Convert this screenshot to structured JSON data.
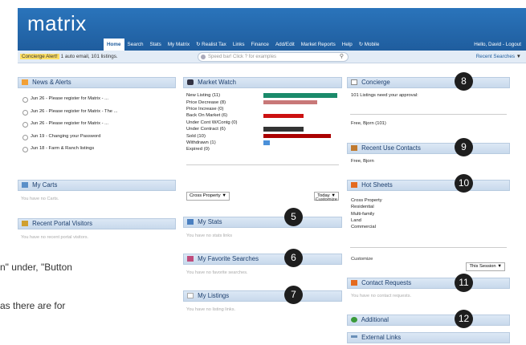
{
  "app": {
    "logo": "matrix"
  },
  "nav": {
    "items": [
      "Home",
      "Search",
      "Stats",
      "My Matrix",
      "Realist Tax",
      "Links",
      "Finance",
      "Add/Edit",
      "Market Reports",
      "Help",
      "Mobile"
    ],
    "active": "Home",
    "user_links": "Hello, David - Logout"
  },
  "subbar": {
    "alert_label": "Concierge Alert!",
    "alert_text": "1 auto email, 101 listings.",
    "speedbar_placeholder": "Speed bar! Click ? for examples",
    "recent_searches": "Recent Searches"
  },
  "news": {
    "title": "News & Alerts",
    "items": [
      "Jun 26 - Please register for Matrix - ...",
      "Jun 26 - Please register for Matrix - The ...",
      "Jun 26 - Please register for Matrix - ...",
      "Jun 19 - Changing your Password",
      "Jun 18 - Farm & Ranch listings"
    ]
  },
  "carts": {
    "title": "My Carts",
    "empty": "You have no Carts."
  },
  "portal": {
    "title": "Recent Portal Visitors",
    "empty": "You have no recent portal visitors."
  },
  "market_watch": {
    "title": "Market Watch",
    "rows": [
      {
        "label": "New Listing (11)",
        "value": 11,
        "color": "#1a8a6a"
      },
      {
        "label": "Price Decrease (8)",
        "value": 8,
        "color": "#c87878"
      },
      {
        "label": "Price Increase (0)",
        "value": 0,
        "color": "#999999"
      },
      {
        "label": "Back On Market (6)",
        "value": 6,
        "color": "#cc1111"
      },
      {
        "label": "Under Cont W/Contg (0)",
        "value": 0,
        "color": "#999999"
      },
      {
        "label": "Under Contract (6)",
        "value": 6,
        "color": "#333333"
      },
      {
        "label": "Sold (10)",
        "value": 10,
        "color": "#aa0000"
      },
      {
        "label": "Withdrawn (1)",
        "value": 1,
        "color": "#4a90d9"
      },
      {
        "label": "Expired (0)",
        "value": 0,
        "color": "#999999"
      }
    ],
    "max_value": 11,
    "property_select": "Cross Property",
    "period_select": "Today",
    "customize": "Customize"
  },
  "my_stats": {
    "title": "My Stats",
    "empty": "You have no stats links"
  },
  "fav_searches": {
    "title": "My Favorite Searches",
    "empty": "You have no favorite searches."
  },
  "my_listings": {
    "title": "My Listings",
    "empty": "You have no listing links."
  },
  "concierge": {
    "title": "Concierge",
    "line1": "101 Listings need your approval:",
    "line2": "Free, Bjorn (101)"
  },
  "recent_contacts": {
    "title": "Recent Use Contacts",
    "line1": "Free, Bjorn"
  },
  "hot_sheets": {
    "title": "Hot Sheets",
    "items": [
      "Cross Property",
      "Residential",
      "Multi-family",
      "Land",
      "Commercial"
    ],
    "customize": "Customize",
    "period_select": "This Session"
  },
  "contact_requests": {
    "title": "Contact Requests",
    "empty": "You have no contact requests."
  },
  "additional": {
    "title": "Additional"
  },
  "external_links": {
    "title": "External Links"
  },
  "callouts": [
    "5",
    "6",
    "7",
    "8",
    "9",
    "10",
    "11",
    "12"
  ],
  "cut_text": {
    "line1": "n\" under, \"Button",
    "line2": "as there are for"
  }
}
